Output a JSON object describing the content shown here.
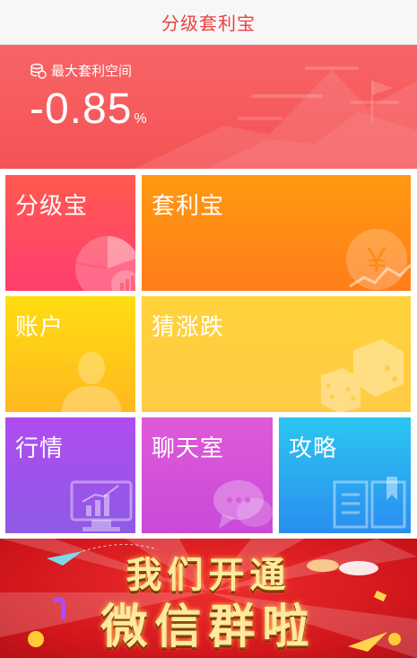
{
  "header": {
    "title": "分级套利宝"
  },
  "hero": {
    "label": "最大套利空间",
    "value": "-0.85",
    "unit": "%"
  },
  "tiles": [
    {
      "label": "分级宝",
      "icon": "pie-chart-icon"
    },
    {
      "label": "套利宝",
      "icon": "yuan-coin-icon"
    },
    {
      "label": "账户",
      "icon": "person-icon"
    },
    {
      "label": "猜涨跌",
      "icon": "dice-icon"
    },
    {
      "label": "行情",
      "icon": "monitor-chart-icon"
    },
    {
      "label": "聊天室",
      "icon": "chat-bubble-icon"
    },
    {
      "label": "攻略",
      "icon": "open-book-icon"
    }
  ],
  "banner": {
    "line1": "我们开通",
    "line2": "微信群啦"
  },
  "colors": {
    "brand_red": "#e8423f",
    "hero_red": "#f45355",
    "tile_fenji": "#ff4f5e",
    "tile_taoli": "#ff8c16",
    "tile_zhanghu": "#ffcc18",
    "tile_caizhang": "#ffcf40",
    "tile_hangqing": "#a050ea",
    "tile_liaotian": "#d552d8",
    "tile_gonglue": "#2ba8f0",
    "banner_red": "#d0161c"
  }
}
